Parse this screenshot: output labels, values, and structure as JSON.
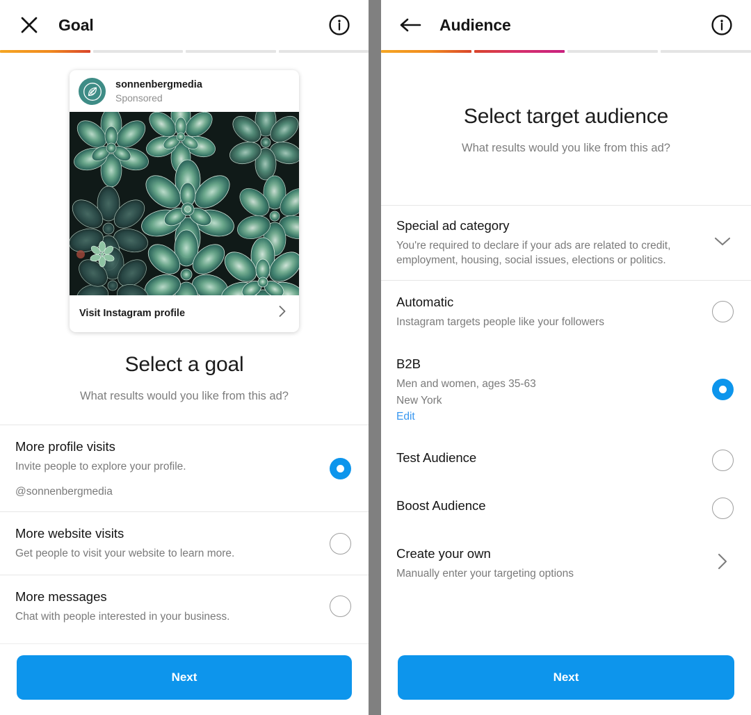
{
  "colors": {
    "accent_blue": "#0d95ec",
    "link_blue": "#3897f0",
    "progress_orange_start": "#f5a623",
    "progress_orange_end": "#d9452b",
    "progress_magenta_end": "#c9217f",
    "avatar_teal": "#3e8c86",
    "divider_gray": "#808080"
  },
  "goal_screen": {
    "nav": {
      "close_icon": "close-icon",
      "title": "Goal",
      "info_icon": "info-icon"
    },
    "progress": {
      "total_steps": 4,
      "completed_steps": 1
    },
    "ad_preview": {
      "username": "sonnenbergmedia",
      "sponsored_label": "Sponsored",
      "avatar_icon": "leaf-logo-icon",
      "photo_alt": "succulent-plants-photo",
      "cta_label": "Visit Instagram profile",
      "cta_chevron": "chevron-right-icon"
    },
    "heading": "Select a goal",
    "subheading": "What results would you like from this ad?",
    "options": [
      {
        "title": "More profile visits",
        "description": "Invite people to explore your profile.",
        "extra": "@sonnenbergmedia",
        "selected": true
      },
      {
        "title": "More website visits",
        "description": "Get people to visit your website to learn more.",
        "extra": "",
        "selected": false
      },
      {
        "title": "More messages",
        "description": "Chat with people interested in your business.",
        "extra": "",
        "selected": false
      }
    ],
    "next_label": "Next"
  },
  "audience_screen": {
    "nav": {
      "back_icon": "arrow-left-icon",
      "title": "Audience",
      "info_icon": "info-icon"
    },
    "progress": {
      "total_steps": 4,
      "completed_steps": 2
    },
    "heading": "Select target audience",
    "subheading": "What results would you like from this ad?",
    "special_category": {
      "title": "Special ad category",
      "description": "You're required to declare if your ads are related to credit, employment, housing, social issues, elections or politics.",
      "chevron": "chevron-down-icon"
    },
    "options": [
      {
        "title": "Automatic",
        "description": "Instagram targets people like your followers",
        "extra": "",
        "extra2": "",
        "link": "",
        "selected": false
      },
      {
        "title": "B2B",
        "description": "Men and women, ages 35-63",
        "extra": "New York",
        "link": "Edit",
        "selected": true
      },
      {
        "title": "Test Audience",
        "description": "",
        "extra": "",
        "link": "",
        "selected": false
      },
      {
        "title": "Boost Audience",
        "description": "",
        "extra": "",
        "link": "",
        "selected": false
      }
    ],
    "create_own": {
      "title": "Create your own",
      "description": "Manually enter your targeting options",
      "chevron": "chevron-right-icon"
    },
    "next_label": "Next"
  }
}
